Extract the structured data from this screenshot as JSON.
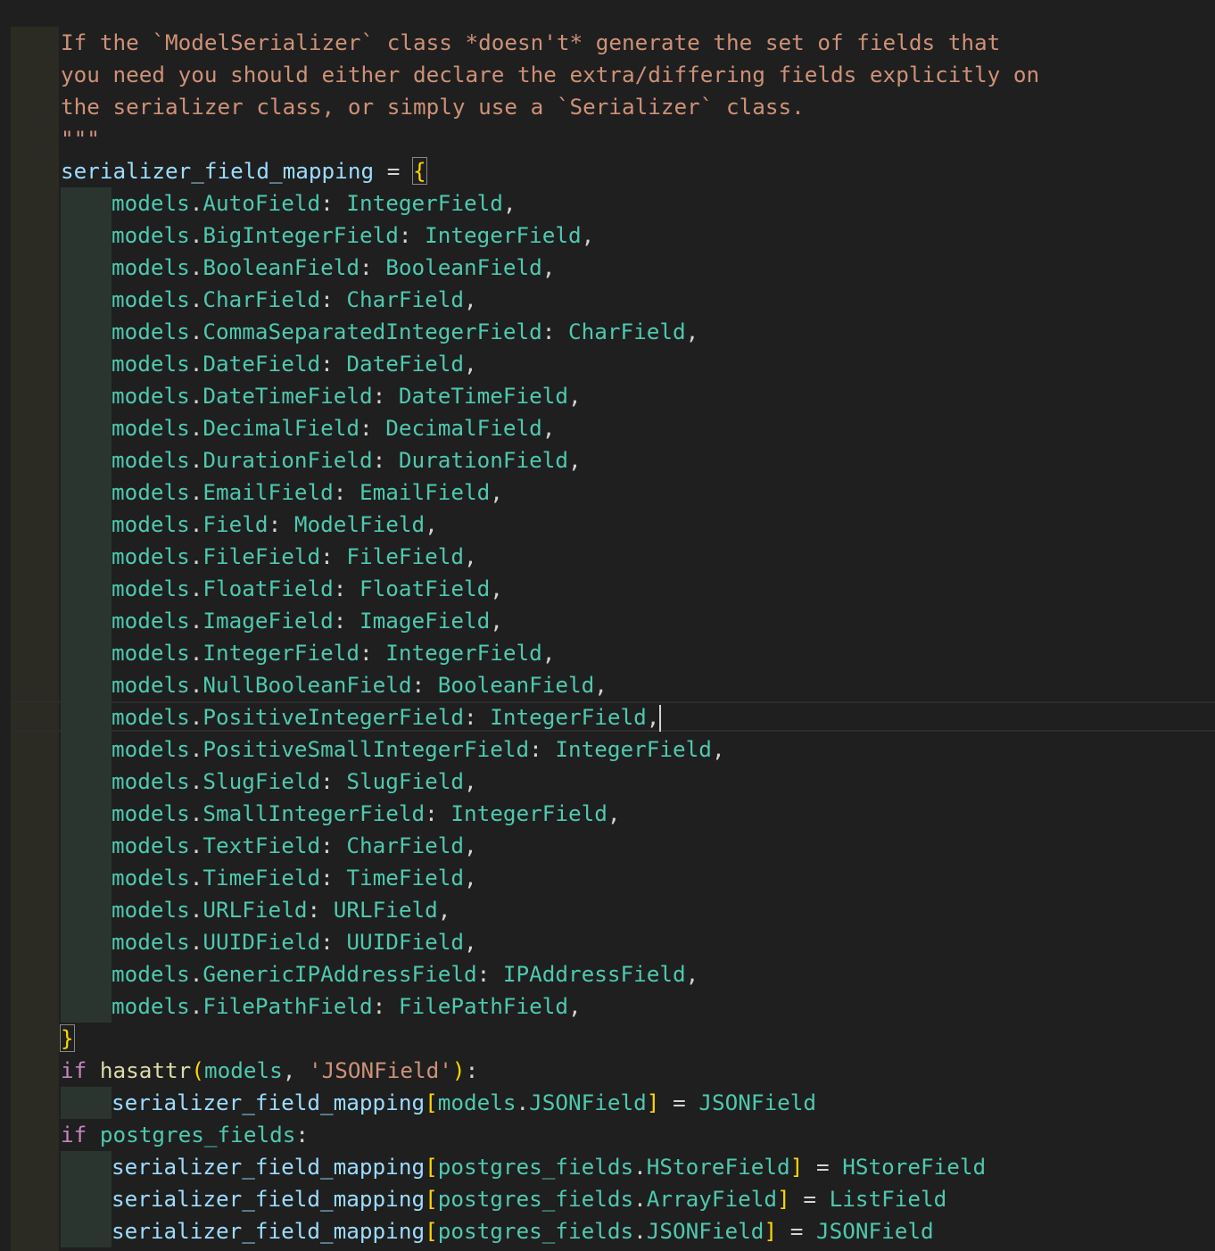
{
  "docstring": [
    "If the `ModelSerializer` class *doesn't* generate the set of fields that",
    "you need you should either declare the extra/differing fields explicitly on",
    "the serializer class, or simply use a `Serializer` class.",
    "\"\"\""
  ],
  "mapping_var": "serializer_field_mapping",
  "assign_op": " = ",
  "open_brace": "{",
  "close_brace": "}",
  "module": "models",
  "entries": [
    {
      "model": "AutoField",
      "field": "IntegerField"
    },
    {
      "model": "BigIntegerField",
      "field": "IntegerField"
    },
    {
      "model": "BooleanField",
      "field": "BooleanField"
    },
    {
      "model": "CharField",
      "field": "CharField"
    },
    {
      "model": "CommaSeparatedIntegerField",
      "field": "CharField"
    },
    {
      "model": "DateField",
      "field": "DateField"
    },
    {
      "model": "DateTimeField",
      "field": "DateTimeField"
    },
    {
      "model": "DecimalField",
      "field": "DecimalField"
    },
    {
      "model": "DurationField",
      "field": "DurationField"
    },
    {
      "model": "EmailField",
      "field": "EmailField"
    },
    {
      "model": "Field",
      "field": "ModelField"
    },
    {
      "model": "FileField",
      "field": "FileField"
    },
    {
      "model": "FloatField",
      "field": "FloatField"
    },
    {
      "model": "ImageField",
      "field": "ImageField"
    },
    {
      "model": "IntegerField",
      "field": "IntegerField"
    },
    {
      "model": "NullBooleanField",
      "field": "BooleanField"
    },
    {
      "model": "PositiveIntegerField",
      "field": "IntegerField"
    },
    {
      "model": "PositiveSmallIntegerField",
      "field": "IntegerField"
    },
    {
      "model": "SlugField",
      "field": "SlugField"
    },
    {
      "model": "SmallIntegerField",
      "field": "IntegerField"
    },
    {
      "model": "TextField",
      "field": "CharField"
    },
    {
      "model": "TimeField",
      "field": "TimeField"
    },
    {
      "model": "URLField",
      "field": "URLField"
    },
    {
      "model": "UUIDField",
      "field": "UUIDField"
    },
    {
      "model": "GenericIPAddressField",
      "field": "IPAddressField"
    },
    {
      "model": "FilePathField",
      "field": "FilePathField"
    }
  ],
  "cursor_entry_index": 16,
  "kw_if": "if",
  "hasattr_fn": "hasattr",
  "hasattr_arg_module": "models",
  "hasattr_arg_str": "'JSONField'",
  "json_model_attr": "JSONField",
  "json_field": "JSONField",
  "postgres_module": "postgres_fields",
  "postgres_entries": [
    {
      "model": "HStoreField",
      "field": "HStoreField"
    },
    {
      "model": "ArrayField",
      "field": "ListField"
    },
    {
      "model": "JSONField",
      "field": "JSONField"
    }
  ]
}
